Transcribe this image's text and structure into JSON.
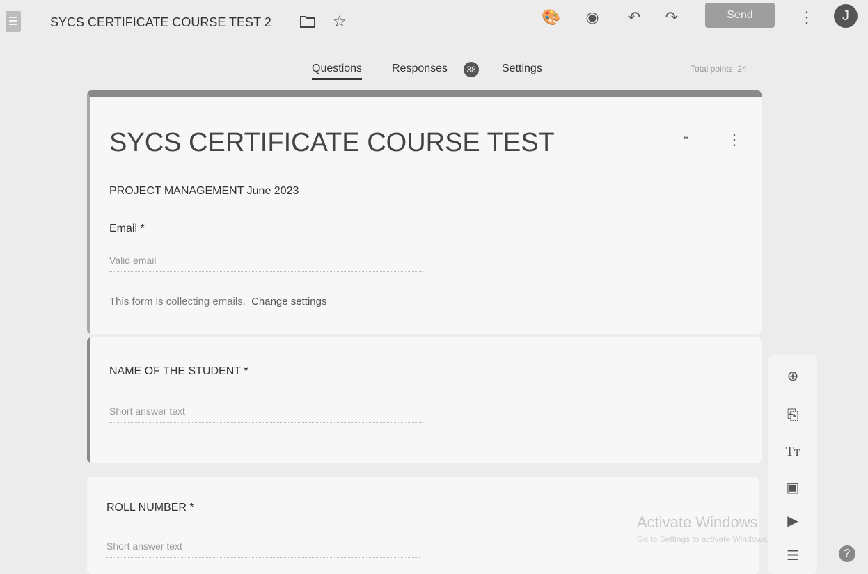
{
  "header": {
    "doc_title": "SYCS CERTIFICATE COURSE TEST 2",
    "send_label": "Send",
    "avatar_letter": "J"
  },
  "tabs": {
    "questions": "Questions",
    "responses": "Responses",
    "responses_count": "38",
    "settings": "Settings",
    "total_points": "Total points: 24"
  },
  "form": {
    "title": "SYCS CERTIFICATE COURSE TEST",
    "description": "PROJECT MANAGEMENT June 2023",
    "email_label": "Email *",
    "email_placeholder": "Valid email",
    "collecting_note": "This form is collecting emails.",
    "change_settings": "Change settings"
  },
  "questions": [
    {
      "label": "NAME OF THE STUDENT *",
      "placeholder": "Short answer text"
    },
    {
      "label": "ROLL NUMBER *",
      "placeholder": "Short answer text"
    }
  ],
  "watermark": {
    "title": "Activate Windows",
    "subtitle": "Go to Settings to activate Windows."
  },
  "icons": {
    "toolbar": [
      "palette-icon",
      "preview-eye-icon",
      "undo-icon",
      "redo-icon",
      "more-vert-icon"
    ],
    "side": [
      "add-question-icon",
      "import-questions-icon",
      "add-title-icon",
      "add-image-icon",
      "add-video-icon",
      "add-section-icon"
    ],
    "help": "help-icon"
  },
  "colors": {
    "background": "#ececec",
    "card": "#f7f7f7",
    "accent": "#8a8a8a",
    "send_button": "#9e9e9e"
  }
}
